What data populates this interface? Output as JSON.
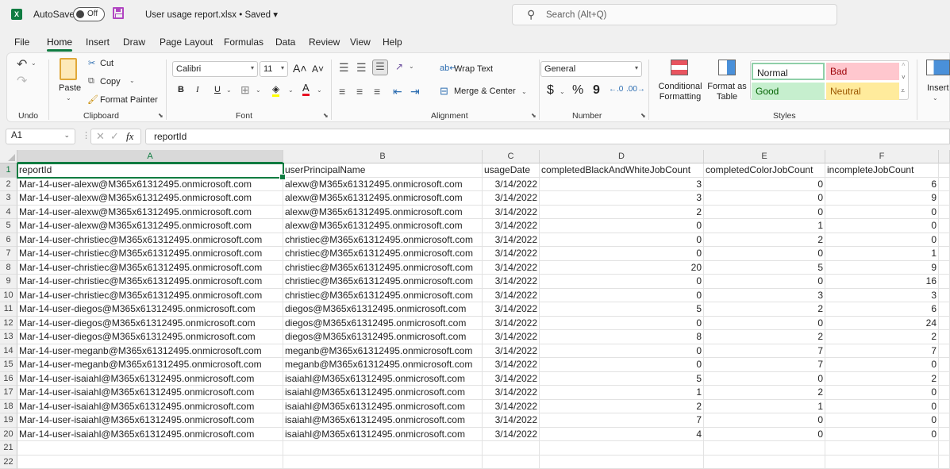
{
  "titlebar": {
    "app_icon": "X",
    "autosave_label": "AutoSave",
    "autosave_state": "Off",
    "document_title": "User usage report.xlsx • Saved ▾",
    "search_placeholder": "Search (Alt+Q)"
  },
  "menu": [
    "File",
    "Home",
    "Insert",
    "Draw",
    "Page Layout",
    "Formulas",
    "Data",
    "Review",
    "View",
    "Help"
  ],
  "menu_active": "Home",
  "ribbon": {
    "undo_group": "Undo",
    "clipboard": {
      "paste": "Paste",
      "cut": "Cut",
      "copy": "Copy",
      "format_painter": "Format Painter",
      "label": "Clipboard"
    },
    "font": {
      "name": "Calibri",
      "size": "11",
      "bold": "B",
      "italic": "I",
      "underline": "U",
      "label": "Font",
      "font_color": "#e81123",
      "highlight_color": "#ffff00"
    },
    "alignment": {
      "wrap_text": "Wrap Text",
      "merge_center": "Merge & Center",
      "label": "Alignment"
    },
    "number": {
      "format": "General",
      "currency": "$",
      "percent": "%",
      "comma": "9",
      "label": "Number"
    },
    "styles": {
      "conditional_formatting": "Conditional Formatting",
      "format_as_table": "Format as Table",
      "normal": "Normal",
      "bad": "Bad",
      "good": "Good",
      "neutral": "Neutral",
      "label": "Styles",
      "colors": {
        "normal_border": "#8fcfa8",
        "bad_bg": "#ffc7ce",
        "bad_fg": "#9c0006",
        "good_bg": "#c6efce",
        "good_fg": "#006100",
        "neutral_bg": "#ffeb9c",
        "neutral_fg": "#9c5700"
      }
    },
    "cells": {
      "insert": "Insert"
    }
  },
  "formula_bar": {
    "name_box": "A1",
    "content": "reportId"
  },
  "sheet": {
    "columns": [
      "A",
      "B",
      "C",
      "D",
      "E",
      "F"
    ],
    "headers": [
      "reportId",
      "userPrincipalName",
      "usageDate",
      "completedBlackAndWhiteJobCount",
      "completedColorJobCount",
      "incompleteJobCount"
    ],
    "rows": [
      [
        "Mar-14-user-alexw@M365x61312495.onmicrosoft.com",
        "alexw@M365x61312495.onmicrosoft.com",
        "3/14/2022",
        "3",
        "0",
        "6"
      ],
      [
        "Mar-14-user-alexw@M365x61312495.onmicrosoft.com",
        "alexw@M365x61312495.onmicrosoft.com",
        "3/14/2022",
        "3",
        "0",
        "9"
      ],
      [
        "Mar-14-user-alexw@M365x61312495.onmicrosoft.com",
        "alexw@M365x61312495.onmicrosoft.com",
        "3/14/2022",
        "2",
        "0",
        "0"
      ],
      [
        "Mar-14-user-alexw@M365x61312495.onmicrosoft.com",
        "alexw@M365x61312495.onmicrosoft.com",
        "3/14/2022",
        "0",
        "1",
        "0"
      ],
      [
        "Mar-14-user-christiec@M365x61312495.onmicrosoft.com",
        "christiec@M365x61312495.onmicrosoft.com",
        "3/14/2022",
        "0",
        "2",
        "0"
      ],
      [
        "Mar-14-user-christiec@M365x61312495.onmicrosoft.com",
        "christiec@M365x61312495.onmicrosoft.com",
        "3/14/2022",
        "0",
        "0",
        "1"
      ],
      [
        "Mar-14-user-christiec@M365x61312495.onmicrosoft.com",
        "christiec@M365x61312495.onmicrosoft.com",
        "3/14/2022",
        "20",
        "5",
        "9"
      ],
      [
        "Mar-14-user-christiec@M365x61312495.onmicrosoft.com",
        "christiec@M365x61312495.onmicrosoft.com",
        "3/14/2022",
        "0",
        "0",
        "16"
      ],
      [
        "Mar-14-user-christiec@M365x61312495.onmicrosoft.com",
        "christiec@M365x61312495.onmicrosoft.com",
        "3/14/2022",
        "0",
        "3",
        "3"
      ],
      [
        "Mar-14-user-diegos@M365x61312495.onmicrosoft.com",
        "diegos@M365x61312495.onmicrosoft.com",
        "3/14/2022",
        "5",
        "2",
        "6"
      ],
      [
        "Mar-14-user-diegos@M365x61312495.onmicrosoft.com",
        "diegos@M365x61312495.onmicrosoft.com",
        "3/14/2022",
        "0",
        "0",
        "24"
      ],
      [
        "Mar-14-user-diegos@M365x61312495.onmicrosoft.com",
        "diegos@M365x61312495.onmicrosoft.com",
        "3/14/2022",
        "8",
        "2",
        "2"
      ],
      [
        "Mar-14-user-meganb@M365x61312495.onmicrosoft.com",
        "meganb@M365x61312495.onmicrosoft.com",
        "3/14/2022",
        "0",
        "7",
        "7"
      ],
      [
        "Mar-14-user-meganb@M365x61312495.onmicrosoft.com",
        "meganb@M365x61312495.onmicrosoft.com",
        "3/14/2022",
        "0",
        "7",
        "0"
      ],
      [
        "Mar-14-user-isaiahl@M365x61312495.onmicrosoft.com",
        "isaiahl@M365x61312495.onmicrosoft.com",
        "3/14/2022",
        "5",
        "0",
        "2"
      ],
      [
        "Mar-14-user-isaiahl@M365x61312495.onmicrosoft.com",
        "isaiahl@M365x61312495.onmicrosoft.com",
        "3/14/2022",
        "1",
        "2",
        "0"
      ],
      [
        "Mar-14-user-isaiahl@M365x61312495.onmicrosoft.com",
        "isaiahl@M365x61312495.onmicrosoft.com",
        "3/14/2022",
        "2",
        "1",
        "0"
      ],
      [
        "Mar-14-user-isaiahl@M365x61312495.onmicrosoft.com",
        "isaiahl@M365x61312495.onmicrosoft.com",
        "3/14/2022",
        "7",
        "0",
        "0"
      ],
      [
        "Mar-14-user-isaiahl@M365x61312495.onmicrosoft.com",
        "isaiahl@M365x61312495.onmicrosoft.com",
        "3/14/2022",
        "4",
        "0",
        "0"
      ]
    ],
    "empty_row_numbers": [
      "21",
      "22"
    ],
    "accent": "#107c41"
  }
}
